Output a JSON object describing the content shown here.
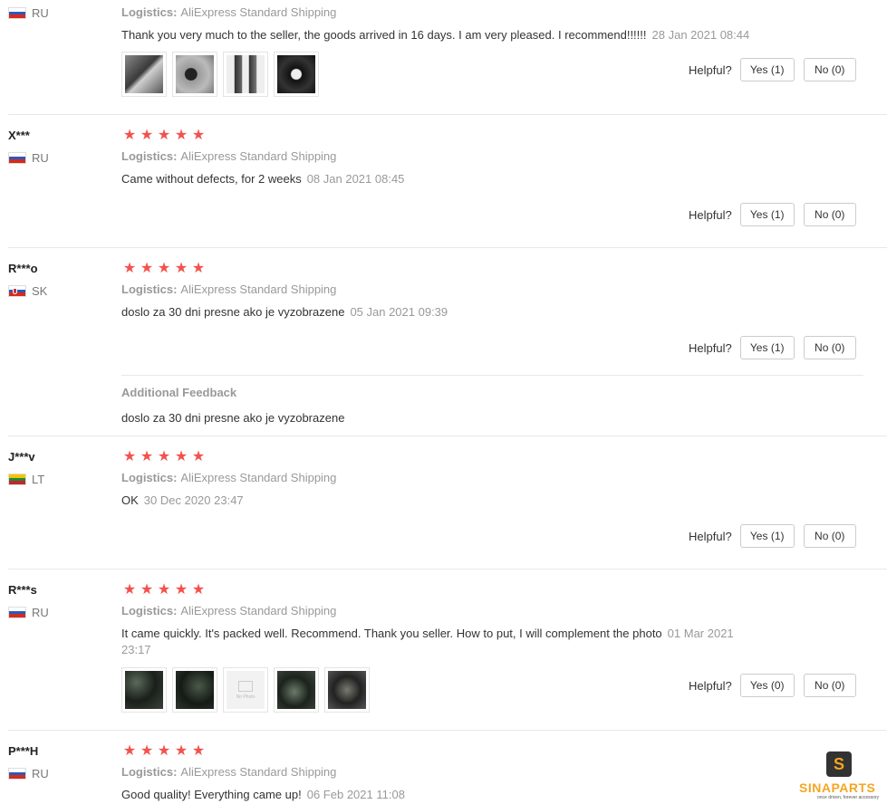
{
  "helpful_label": "Helpful?",
  "colors": {
    "star": "#f2524d",
    "muted": "#999999",
    "brand": "#f5a623"
  },
  "reviews": [
    {
      "country": "RU",
      "logistics_label": "Logistics:",
      "logistics": "AliExpress Standard Shipping",
      "text": "Thank you very much to the seller, the goods arrived in 16 days. I am very pleased. I recommend!!!!!!",
      "date": "28 Jan 2021 08:44",
      "yes": "Yes (1)",
      "no": "No (0)"
    },
    {
      "name": "X***",
      "country": "RU",
      "rating": 5,
      "logistics_label": "Logistics:",
      "logistics": "AliExpress Standard Shipping",
      "text": "Came without defects, for 2 weeks",
      "date": "08 Jan 2021 08:45",
      "yes": "Yes (1)",
      "no": "No (0)"
    },
    {
      "name": "R***o",
      "country": "SK",
      "rating": 5,
      "logistics_label": "Logistics:",
      "logistics": "AliExpress Standard Shipping",
      "text": "doslo za 30 dni presne ako je vyzobrazene",
      "date": "05 Jan 2021 09:39",
      "yes": "Yes (1)",
      "no": "No (0)",
      "additional_title": "Additional Feedback",
      "additional_text": "doslo za 30 dni presne ako je vyzobrazene"
    },
    {
      "name": "J***v",
      "country": "LT",
      "rating": 5,
      "logistics_label": "Logistics:",
      "logistics": "AliExpress Standard Shipping",
      "text": "OK",
      "date": "30 Dec 2020 23:47",
      "yes": "Yes (1)",
      "no": "No (0)"
    },
    {
      "name": "R***s",
      "country": "RU",
      "rating": 5,
      "logistics_label": "Logistics:",
      "logistics": "AliExpress Standard Shipping",
      "text": "It came quickly. It's packed well. Recommend. Thank you seller. How to put, I will complement the photo",
      "date_line1": "01 Mar 2021",
      "date_line2": "23:17",
      "yes": "Yes (0)",
      "no": "No (0)",
      "no_photo_label": "No Photo"
    },
    {
      "name": "P***H",
      "country": "RU",
      "rating": 5,
      "logistics_label": "Logistics:",
      "logistics": "AliExpress Standard Shipping",
      "text": "Good quality! Everything came up!",
      "date": "06 Feb 2021 11:08"
    }
  ],
  "watermark": {
    "badge": "S",
    "name": "SINAPARTS",
    "tagline": "once driven, forever accessory"
  }
}
